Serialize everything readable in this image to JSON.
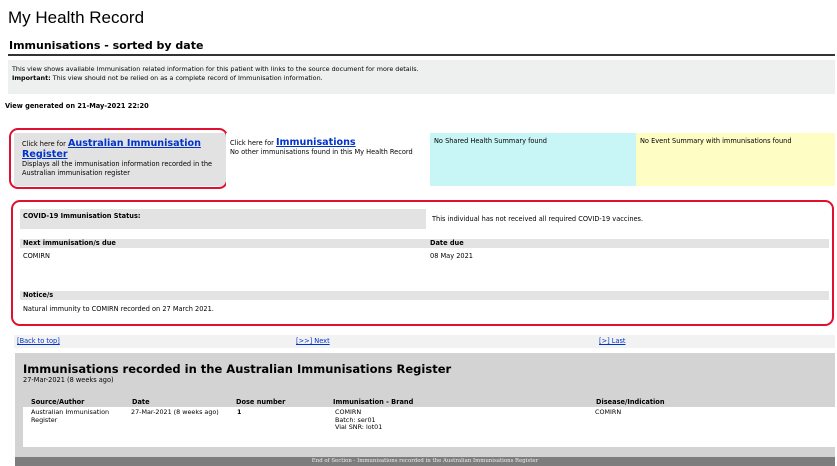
{
  "page_title": "My Health Record",
  "section_title": "Immunisations - sorted by date",
  "intro": {
    "line1": "This view shows available Immunisation related information for this patient with links to the source document for more details.",
    "important_label": "Important:",
    "line2": " This view should not be relied on as a complete record of Immunisation information."
  },
  "generated": "View generated on 21-May-2021 22:20",
  "cards": {
    "air": {
      "prefix": "Click here for ",
      "link": "Australian Immunisation Register",
      "desc": "Displays all the immunisation information recorded in the Australian immunisation register"
    },
    "imm": {
      "prefix": "Click here for ",
      "link": "Immunisations",
      "desc": "No other immunisations found in this My Health Record"
    },
    "shs": {
      "text": "No Shared Health Summary found"
    },
    "event": {
      "text": "No Event Summary with immunisations found"
    }
  },
  "status": {
    "covid_label": "COVID-19 Immunisation Status:",
    "covid_value": "This individual has not received all required COVID-19 vaccines.",
    "next_label": "Next immunisation/s due",
    "date_label": "Date due",
    "next_value": "COMIRN",
    "date_value": "08 May 2021",
    "notice_label": "Notice/s",
    "notice_value": "Natural immunity to COMIRN recorded on 27 March 2021."
  },
  "nav": {
    "top": "[Back to top]",
    "next": "[>>] Next",
    "last": "[>] Last"
  },
  "register": {
    "title": "Immunisations recorded in the Australian Immunisations Register",
    "date": "27-Mar-2021 (8 weeks ago)",
    "headers": {
      "source": "Source/Author",
      "date": "Date",
      "dose": "Dose number",
      "brand": "Immunisation - Brand",
      "disease": "Disease/Indication"
    },
    "row": {
      "source": "Australian Immunisation Register",
      "date": "27-Mar-2021 (8 weeks ago)",
      "dose": "1",
      "brand": "COMIRN",
      "batch": "Batch: ser01",
      "vial": "Vial SNR: lot01",
      "disease": "COMIRN"
    }
  },
  "footer": "End of Section - Immunisations recorded in the Australian Immunisations Register",
  "colors": {
    "highlight": "#e01030",
    "link": "#0033cc",
    "cyan": "#c8f6f6",
    "yellow": "#fdfdc4"
  }
}
